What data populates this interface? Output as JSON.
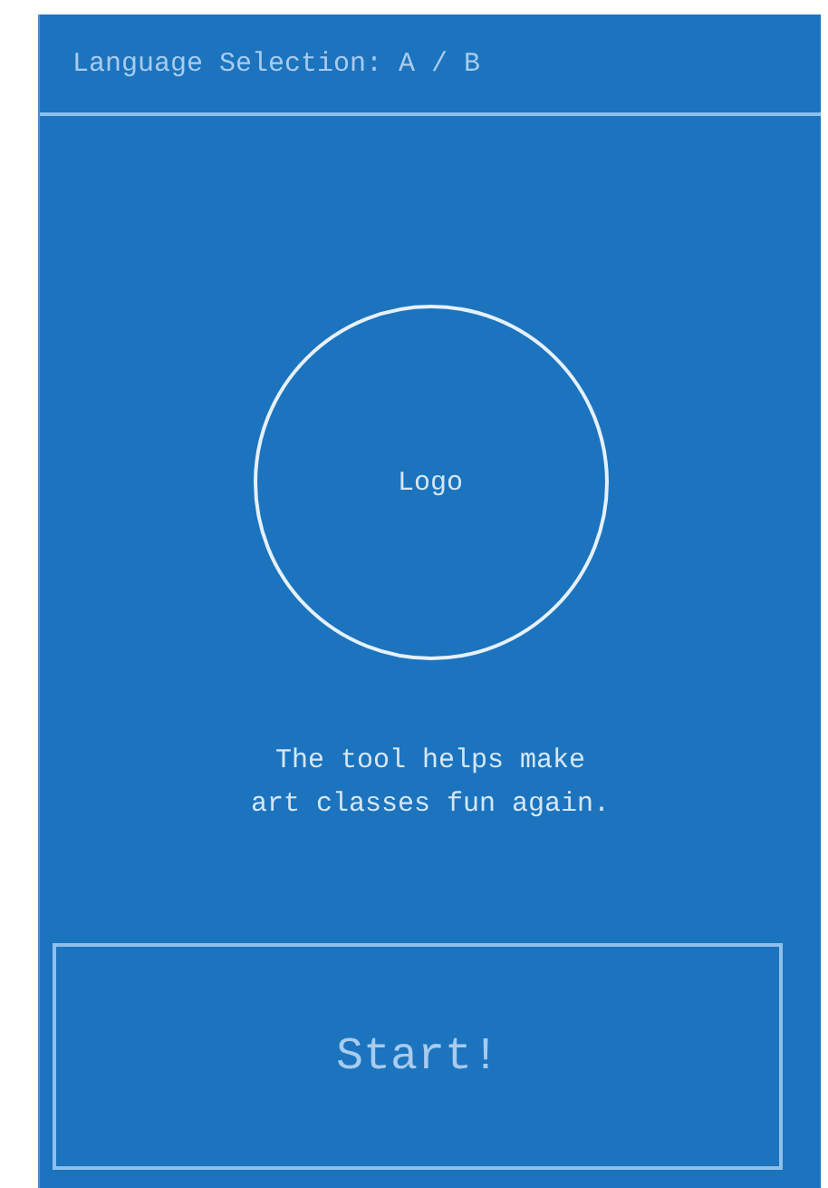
{
  "header": {
    "title": "Language Selection: A / B"
  },
  "logo": {
    "label": "Logo"
  },
  "tagline": [
    "The tool helps make",
    "art classes fun again."
  ],
  "start_button": {
    "label": "Start!"
  }
}
